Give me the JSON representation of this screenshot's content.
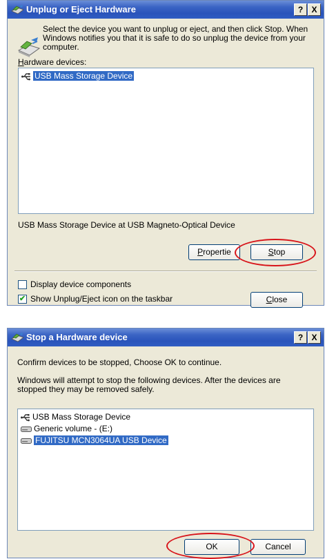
{
  "dialog1": {
    "title": "Unplug or Eject Hardware",
    "help_button": "?",
    "close_button": "X",
    "instructions": [
      "Select the device you want to unplug or eject, and then click Stop. When",
      "Windows notifies you that it is safe to do so unplug the device from your",
      "computer."
    ],
    "hardware_label": "Hardware devices:",
    "devices": [
      {
        "label": "USB Mass Storage Device",
        "icon": "usb-icon",
        "selected": true
      }
    ],
    "device_description": "USB Mass Storage Device at USB Magneto-Optical Device",
    "properties_button": "Propertie",
    "stop_button": "Stop",
    "display_components_label": "Display device components",
    "display_components_checked": false,
    "show_icon_label": "Show Unplug/Eject icon on the taskbar",
    "show_icon_checked": true,
    "close_label": "Close"
  },
  "dialog2": {
    "title": "Stop a Hardware device",
    "help_button": "?",
    "close_button": "X",
    "confirm_text": "Confirm devices to be stopped, Choose OK to continue.",
    "info_text": [
      "Windows will attempt to stop the following devices. After the devices are",
      "stopped they may be removed safely."
    ],
    "devices": [
      {
        "label": "USB Mass Storage Device",
        "icon": "usb-icon",
        "selected": false
      },
      {
        "label": "Generic volume - (E:)",
        "icon": "drive-icon",
        "selected": false
      },
      {
        "label": "FUJITSU MCN3064UA USB Device",
        "icon": "drive-icon",
        "selected": true
      }
    ],
    "ok_button": "OK",
    "cancel_button": "Cancel"
  },
  "colors": {
    "title_bar": "#2a54bb",
    "dialog_bg": "#ece9d8",
    "selection": "#316ac5",
    "annotation_circle": "#d8141a"
  }
}
